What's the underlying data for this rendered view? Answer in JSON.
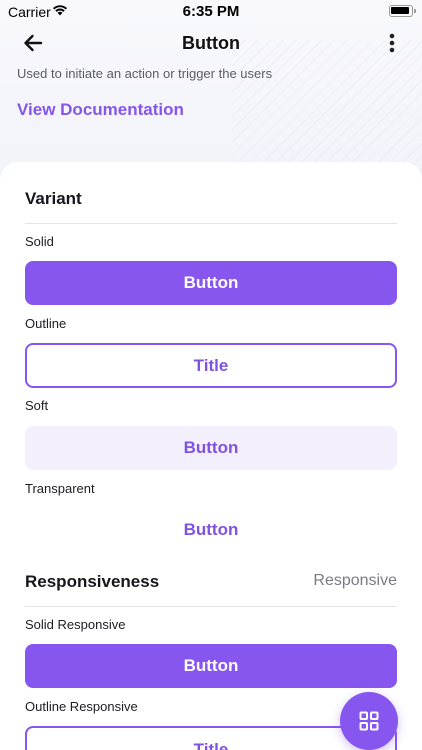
{
  "status_bar": {
    "carrier": "Carrier",
    "time": "6:35 PM"
  },
  "header": {
    "title": "Button",
    "subtitle": "Used to initiate an action or trigger the users",
    "doc_link": "View Documentation",
    "back_icon": "arrow-left-icon",
    "more_icon": "more-vertical-icon"
  },
  "variant": {
    "title": "Variant",
    "items": [
      {
        "label": "Solid",
        "button": "Button"
      },
      {
        "label": "Outline",
        "button": "Title"
      },
      {
        "label": "Soft",
        "button": "Button"
      },
      {
        "label": "Transparent",
        "button": "Button"
      }
    ]
  },
  "responsiveness": {
    "title": "Responsiveness",
    "right_label": "Responsive",
    "items": [
      {
        "label": "Solid Responsive",
        "button": "Button"
      },
      {
        "label": "Outline Responsive",
        "button": "Title"
      }
    ]
  },
  "fab": {
    "icon": "grid-icon"
  },
  "colors": {
    "accent": "#8656EF",
    "soft": "#F3EFFD"
  }
}
